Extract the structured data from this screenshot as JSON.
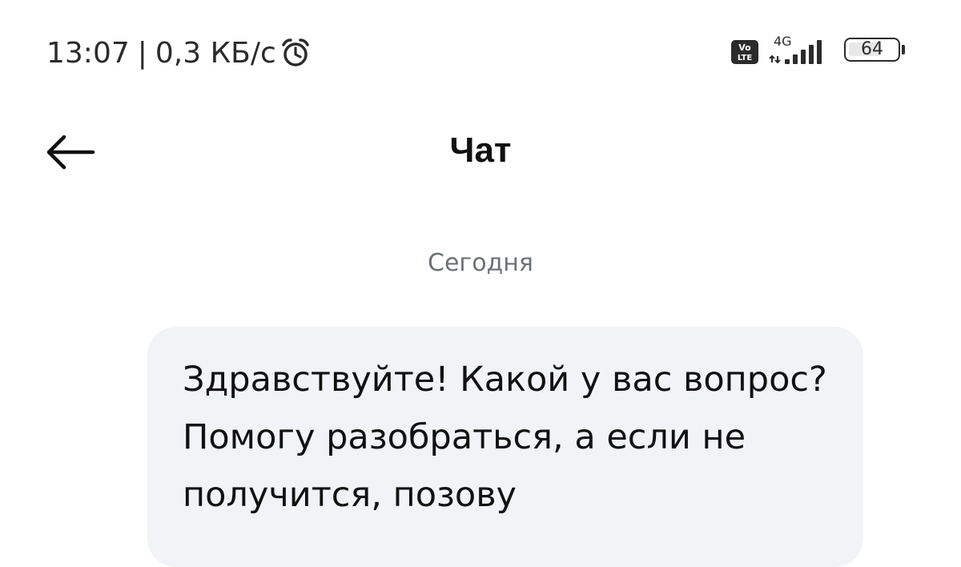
{
  "status_bar": {
    "time": "13:07",
    "separator": "|",
    "speed": "0,3 КБ/с",
    "alarm_icon": "alarm-clock-icon",
    "volte_icon": "volte-icon",
    "network_type": "4G",
    "signal_icon": "cellular-signal-icon",
    "battery_level": "64",
    "battery_icon": "battery-icon"
  },
  "header": {
    "back_icon": "arrow-left-icon",
    "title": "Чат"
  },
  "chat": {
    "date_label": "Сегодня",
    "messages": [
      {
        "text": "Здравствуйте! Какой у вас вопрос? Помогу разобраться, а если не получится, позову"
      }
    ]
  },
  "colors": {
    "background": "#ffffff",
    "bubble": "#f2f3f6",
    "date_text": "#6b7178",
    "text": "#111111"
  }
}
